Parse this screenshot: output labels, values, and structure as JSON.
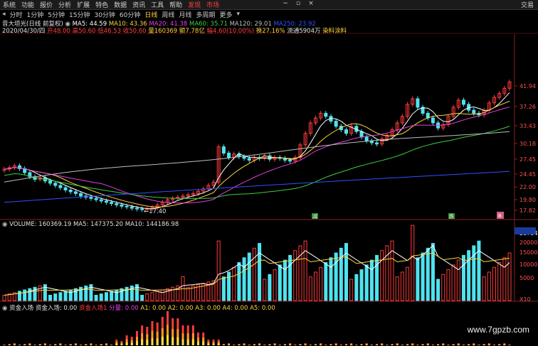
{
  "menu": {
    "items": [
      "系统",
      "功能",
      "报价",
      "分析",
      "扩展",
      "特色",
      "数据",
      "资讯",
      "工具",
      "帮助"
    ],
    "discover": "发现",
    "market": "市场",
    "right_label": "交易",
    "win_min": "−",
    "win_max": "▫",
    "win_close": "×"
  },
  "tabs": {
    "items": [
      "分时",
      "1分钟",
      "5分钟",
      "15分钟",
      "30分钟",
      "60分钟",
      "日线",
      "周线",
      "月线",
      "多周期",
      "更多"
    ],
    "active": "日线"
  },
  "info": {
    "stock": "音大垣光(日线 前复权)",
    "ma5": "MA5: 44.59",
    "ma10": "MA10: 43.36",
    "ma20": "MA20: 41.38",
    "ma60": "MA60: 35.71",
    "ma120": "MA120: 29.01",
    "ma250": "MA250: 23.92",
    "date": "2020/04/30/四",
    "open": "开48.00",
    "high": "高50.60",
    "low": "低46.53",
    "close": "收50.60",
    "vol": "量160369",
    "amt": "额7.78亿",
    "chg": "幅4.60(10.00%)",
    "turn": "换27.16%",
    "float": "流通5904万",
    "industry": "染料涂料"
  },
  "price_axis": [
    "41.94",
    "37.26",
    "33.43",
    "30.18",
    "27.45",
    "24.45",
    "22.00",
    "19.80",
    "17.82"
  ],
  "low_marker": "←17.40",
  "signals": {
    "s1": "减",
    "s2": "跌",
    "s3": "B"
  },
  "volume": {
    "label": "VOLUME: 160369.19",
    "ma5": "MA5: 147375.20",
    "ma10": "MA10: 144186.98",
    "axis": [
      "26784",
      "20000",
      "15000",
      "10000",
      "5000",
      "X10"
    ]
  },
  "capital": {
    "title": "资金入场",
    "t2": "资金入场: 0.00",
    "t3": "资金入场1",
    "t4": "分量: 0.00",
    "a1": "A1: 0.00",
    "a2": "A2: 0.00",
    "a3": "A3: 0.00",
    "a4": "A4: 0.00",
    "a5": "A5: 0.00"
  },
  "watermark": "www.7gpzb.com",
  "colors": {
    "up": "#ff3b3b",
    "down": "#4fe3f0",
    "ma5": "#ffffff",
    "ma10": "#ffd23c",
    "ma20": "#e040e0",
    "ma60": "#3ecf3e",
    "ma120": "#bdbdbd",
    "ma250": "#3050ff"
  }
}
